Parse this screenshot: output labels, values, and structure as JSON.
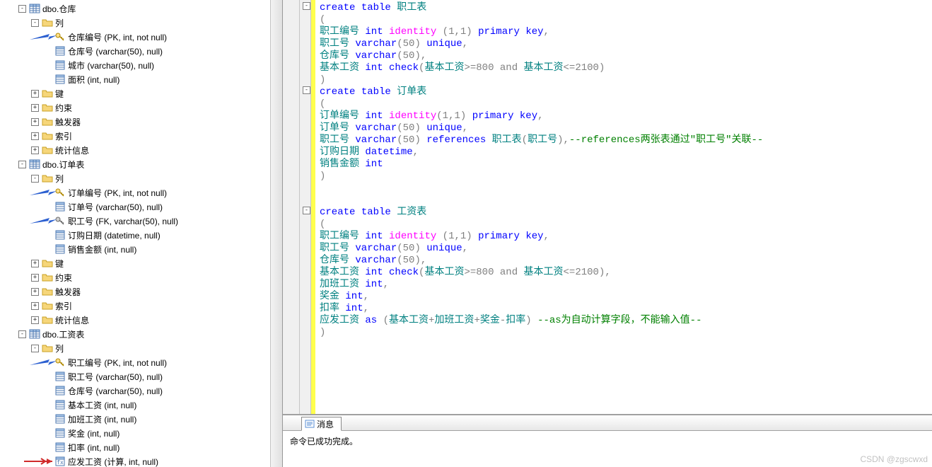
{
  "watermark": "CSDN @zgscwxd",
  "messages": {
    "tab_label": "消息",
    "body": "命令已成功完成。"
  },
  "icons": {
    "table": "table-icon",
    "folder": "folder-icon",
    "key": "key-icon",
    "fkey": "fkey-icon",
    "column": "column-icon",
    "computed": "computed-column-icon"
  },
  "tree": [
    {
      "depth": 1,
      "exp": "-",
      "icon": "table",
      "label": "dbo.仓库",
      "name": "table-dbo-cangku",
      "interact": true
    },
    {
      "depth": 2,
      "exp": "-",
      "icon": "folder",
      "label": "列",
      "name": "folder-columns",
      "interact": true
    },
    {
      "depth": 3,
      "exp": " ",
      "icon": "key",
      "label": "仓库编号 (PK, int, not null)",
      "name": "col-cangku-bianhao",
      "interact": true,
      "arrow": "blue"
    },
    {
      "depth": 3,
      "exp": " ",
      "icon": "column",
      "label": "仓库号 (varchar(50), null)",
      "name": "col-cangku-hao",
      "interact": true
    },
    {
      "depth": 3,
      "exp": " ",
      "icon": "column",
      "label": "城市 (varchar(50), null)",
      "name": "col-chengshi",
      "interact": true
    },
    {
      "depth": 3,
      "exp": " ",
      "icon": "column",
      "label": "面积 (int, null)",
      "name": "col-mianji",
      "interact": true
    },
    {
      "depth": 2,
      "exp": "+",
      "icon": "folder",
      "label": "键",
      "name": "folder-keys",
      "interact": true
    },
    {
      "depth": 2,
      "exp": "+",
      "icon": "folder",
      "label": "约束",
      "name": "folder-constraints",
      "interact": true
    },
    {
      "depth": 2,
      "exp": "+",
      "icon": "folder",
      "label": "触发器",
      "name": "folder-triggers",
      "interact": true
    },
    {
      "depth": 2,
      "exp": "+",
      "icon": "folder",
      "label": "索引",
      "name": "folder-indexes",
      "interact": true
    },
    {
      "depth": 2,
      "exp": "+",
      "icon": "folder",
      "label": "统计信息",
      "name": "folder-stats",
      "interact": true
    },
    {
      "depth": 1,
      "exp": "-",
      "icon": "table",
      "label": "dbo.订单表",
      "name": "table-dbo-dingdan",
      "interact": true
    },
    {
      "depth": 2,
      "exp": "-",
      "icon": "folder",
      "label": "列",
      "name": "folder-columns-2",
      "interact": true
    },
    {
      "depth": 3,
      "exp": " ",
      "icon": "key",
      "label": "订单编号 (PK, int, not null)",
      "name": "col-dingdan-bianhao",
      "interact": true,
      "arrow": "blue"
    },
    {
      "depth": 3,
      "exp": " ",
      "icon": "column",
      "label": "订单号 (varchar(50), null)",
      "name": "col-dingdan-hao",
      "interact": true
    },
    {
      "depth": 3,
      "exp": " ",
      "icon": "fkey",
      "label": "职工号 (FK, varchar(50), null)",
      "name": "col-zhigong-hao-fk",
      "interact": true,
      "arrow": "blue"
    },
    {
      "depth": 3,
      "exp": " ",
      "icon": "column",
      "label": "订购日期 (datetime, null)",
      "name": "col-dinggou-riqi",
      "interact": true
    },
    {
      "depth": 3,
      "exp": " ",
      "icon": "column",
      "label": "销售金额 (int, null)",
      "name": "col-xiaoshou-jine",
      "interact": true
    },
    {
      "depth": 2,
      "exp": "+",
      "icon": "folder",
      "label": "键",
      "name": "folder-keys-2",
      "interact": true
    },
    {
      "depth": 2,
      "exp": "+",
      "icon": "folder",
      "label": "约束",
      "name": "folder-constraints-2",
      "interact": true
    },
    {
      "depth": 2,
      "exp": "+",
      "icon": "folder",
      "label": "触发器",
      "name": "folder-triggers-2",
      "interact": true
    },
    {
      "depth": 2,
      "exp": "+",
      "icon": "folder",
      "label": "索引",
      "name": "folder-indexes-2",
      "interact": true
    },
    {
      "depth": 2,
      "exp": "+",
      "icon": "folder",
      "label": "统计信息",
      "name": "folder-stats-2",
      "interact": true
    },
    {
      "depth": 1,
      "exp": "-",
      "icon": "table",
      "label": "dbo.工资表",
      "name": "table-dbo-gongzi",
      "interact": true
    },
    {
      "depth": 2,
      "exp": "-",
      "icon": "folder",
      "label": "列",
      "name": "folder-columns-3",
      "interact": true
    },
    {
      "depth": 3,
      "exp": " ",
      "icon": "key",
      "label": "职工编号 (PK, int, not null)",
      "name": "col-zhigong-bianhao",
      "interact": true,
      "arrow": "blue"
    },
    {
      "depth": 3,
      "exp": " ",
      "icon": "column",
      "label": "职工号 (varchar(50), null)",
      "name": "col-zhigong-hao",
      "interact": true
    },
    {
      "depth": 3,
      "exp": " ",
      "icon": "column",
      "label": "仓库号 (varchar(50), null)",
      "name": "col-cangku-hao-3",
      "interact": true
    },
    {
      "depth": 3,
      "exp": " ",
      "icon": "column",
      "label": "基本工资 (int, null)",
      "name": "col-jiben-gongzi",
      "interact": true
    },
    {
      "depth": 3,
      "exp": " ",
      "icon": "column",
      "label": "加班工资 (int, null)",
      "name": "col-jiaban-gongzi",
      "interact": true
    },
    {
      "depth": 3,
      "exp": " ",
      "icon": "column",
      "label": "奖金 (int, null)",
      "name": "col-jiangjin",
      "interact": true
    },
    {
      "depth": 3,
      "exp": " ",
      "icon": "column",
      "label": "扣率 (int, null)",
      "name": "col-koulv",
      "interact": true
    },
    {
      "depth": 3,
      "exp": " ",
      "icon": "computed",
      "label": "应发工资 (计算, int, null)",
      "name": "col-yingfa-gongzi",
      "interact": true,
      "arrow": "red"
    }
  ],
  "sql_lines": [
    {
      "fold": "-",
      "tokens": [
        [
          "kw",
          "create"
        ],
        [
          "",
          ""
        ],
        [
          "kw",
          "table"
        ],
        [
          "",
          " "
        ],
        [
          "id",
          "职工表"
        ]
      ]
    },
    {
      "tokens": [
        [
          "punc",
          "("
        ]
      ]
    },
    {
      "tokens": [
        [
          "id",
          "职工编号 "
        ],
        [
          "kw",
          "int"
        ],
        [
          "",
          " "
        ],
        [
          "fn",
          "identity"
        ],
        [
          "",
          " "
        ],
        [
          "punc",
          "("
        ],
        [
          "num",
          "1"
        ],
        [
          "punc",
          ","
        ],
        [
          "num",
          "1"
        ],
        [
          "punc",
          ")"
        ],
        [
          "",
          " "
        ],
        [
          "kw",
          "primary"
        ],
        [
          "",
          " "
        ],
        [
          "kw",
          "key"
        ],
        [
          "punc",
          ","
        ]
      ]
    },
    {
      "tokens": [
        [
          "id",
          "职工号 "
        ],
        [
          "kw",
          "varchar"
        ],
        [
          "punc",
          "("
        ],
        [
          "num",
          "50"
        ],
        [
          "punc",
          ")"
        ],
        [
          "",
          " "
        ],
        [
          "kw",
          "unique"
        ],
        [
          "punc",
          ","
        ]
      ]
    },
    {
      "tokens": [
        [
          "id",
          "仓库号 "
        ],
        [
          "kw",
          "varchar"
        ],
        [
          "punc",
          "("
        ],
        [
          "num",
          "50"
        ],
        [
          "punc",
          ")"
        ],
        [
          "punc",
          ","
        ]
      ]
    },
    {
      "tokens": [
        [
          "id",
          "基本工资 "
        ],
        [
          "kw",
          "int"
        ],
        [
          "",
          " "
        ],
        [
          "kw",
          "check"
        ],
        [
          "punc",
          "("
        ],
        [
          "id",
          "基本工资"
        ],
        [
          "op",
          ">="
        ],
        [
          "num",
          "800"
        ],
        [
          "",
          " "
        ],
        [
          "op",
          "and"
        ],
        [
          "",
          " "
        ],
        [
          "id",
          "基本工资"
        ],
        [
          "op",
          "<="
        ],
        [
          "num",
          "2100"
        ],
        [
          "punc",
          ")"
        ]
      ]
    },
    {
      "tokens": [
        [
          "punc",
          ")"
        ]
      ]
    },
    {
      "fold": "-",
      "tokens": [
        [
          "kw",
          "create"
        ],
        [
          "",
          ""
        ],
        [
          "kw",
          "table"
        ],
        [
          "",
          " "
        ],
        [
          "id",
          "订单表"
        ]
      ]
    },
    {
      "tokens": [
        [
          "punc",
          "("
        ]
      ]
    },
    {
      "tokens": [
        [
          "id",
          "订单编号 "
        ],
        [
          "kw",
          "int"
        ],
        [
          "",
          " "
        ],
        [
          "fn",
          "identity"
        ],
        [
          "punc",
          "("
        ],
        [
          "num",
          "1"
        ],
        [
          "punc",
          ","
        ],
        [
          "num",
          "1"
        ],
        [
          "punc",
          ")"
        ],
        [
          "",
          " "
        ],
        [
          "kw",
          "primary"
        ],
        [
          "",
          " "
        ],
        [
          "kw",
          "key"
        ],
        [
          "punc",
          ","
        ]
      ]
    },
    {
      "tokens": [
        [
          "id",
          "订单号 "
        ],
        [
          "kw",
          "varchar"
        ],
        [
          "punc",
          "("
        ],
        [
          "num",
          "50"
        ],
        [
          "punc",
          ")"
        ],
        [
          "",
          " "
        ],
        [
          "kw",
          "unique"
        ],
        [
          "punc",
          ","
        ]
      ]
    },
    {
      "tokens": [
        [
          "id",
          "职工号 "
        ],
        [
          "kw",
          "varchar"
        ],
        [
          "punc",
          "("
        ],
        [
          "num",
          "50"
        ],
        [
          "punc",
          ")"
        ],
        [
          "",
          " "
        ],
        [
          "kw",
          "references"
        ],
        [
          "",
          " "
        ],
        [
          "id",
          "职工表"
        ],
        [
          "punc",
          "("
        ],
        [
          "id",
          "职工号"
        ],
        [
          "punc",
          ")"
        ],
        [
          "punc",
          ","
        ],
        [
          "cmt",
          "--references两张表通过\"职工号\"关联--"
        ]
      ]
    },
    {
      "tokens": [
        [
          "id",
          "订购日期 "
        ],
        [
          "kw",
          "datetime"
        ],
        [
          "punc",
          ","
        ]
      ]
    },
    {
      "tokens": [
        [
          "id",
          "销售金额 "
        ],
        [
          "kw",
          "int"
        ]
      ]
    },
    {
      "tokens": [
        [
          "punc",
          ")"
        ]
      ]
    },
    {
      "tokens": [
        [
          "",
          ""
        ]
      ]
    },
    {
      "tokens": [
        [
          "",
          ""
        ]
      ]
    },
    {
      "fold": "-",
      "tokens": [
        [
          "kw",
          "create"
        ],
        [
          "",
          ""
        ],
        [
          "kw",
          "table"
        ],
        [
          "",
          " "
        ],
        [
          "id",
          "工资表"
        ]
      ]
    },
    {
      "tokens": [
        [
          "punc",
          "("
        ]
      ]
    },
    {
      "tokens": [
        [
          "id",
          "职工编号 "
        ],
        [
          "kw",
          "int"
        ],
        [
          "",
          " "
        ],
        [
          "fn",
          "identity"
        ],
        [
          "",
          " "
        ],
        [
          "punc",
          "("
        ],
        [
          "num",
          "1"
        ],
        [
          "punc",
          ","
        ],
        [
          "num",
          "1"
        ],
        [
          "punc",
          ")"
        ],
        [
          "",
          " "
        ],
        [
          "kw",
          "primary"
        ],
        [
          "",
          " "
        ],
        [
          "kw",
          "key"
        ],
        [
          "punc",
          ","
        ]
      ]
    },
    {
      "tokens": [
        [
          "id",
          "职工号 "
        ],
        [
          "kw",
          "varchar"
        ],
        [
          "punc",
          "("
        ],
        [
          "num",
          "50"
        ],
        [
          "punc",
          ")"
        ],
        [
          "",
          " "
        ],
        [
          "kw",
          "unique"
        ],
        [
          "punc",
          ","
        ]
      ]
    },
    {
      "tokens": [
        [
          "id",
          "仓库号 "
        ],
        [
          "kw",
          "varchar"
        ],
        [
          "punc",
          "("
        ],
        [
          "num",
          "50"
        ],
        [
          "punc",
          ")"
        ],
        [
          "punc",
          ","
        ]
      ]
    },
    {
      "tokens": [
        [
          "id",
          "基本工资 "
        ],
        [
          "kw",
          "int"
        ],
        [
          "",
          " "
        ],
        [
          "kw",
          "check"
        ],
        [
          "punc",
          "("
        ],
        [
          "id",
          "基本工资"
        ],
        [
          "op",
          ">="
        ],
        [
          "num",
          "800"
        ],
        [
          "",
          " "
        ],
        [
          "op",
          "and"
        ],
        [
          "",
          " "
        ],
        [
          "id",
          "基本工资"
        ],
        [
          "op",
          "<="
        ],
        [
          "num",
          "2100"
        ],
        [
          "punc",
          ")"
        ],
        [
          "punc",
          ","
        ]
      ]
    },
    {
      "tokens": [
        [
          "id",
          "加班工资 "
        ],
        [
          "kw",
          "int"
        ],
        [
          "punc",
          ","
        ]
      ]
    },
    {
      "tokens": [
        [
          "id",
          "奖金 "
        ],
        [
          "kw",
          "int"
        ],
        [
          "punc",
          ","
        ]
      ]
    },
    {
      "tokens": [
        [
          "id",
          "扣率 "
        ],
        [
          "kw",
          "int"
        ],
        [
          "punc",
          ","
        ]
      ]
    },
    {
      "tokens": [
        [
          "id",
          "应发工资 "
        ],
        [
          "kw",
          "as"
        ],
        [
          "",
          " "
        ],
        [
          "punc",
          "("
        ],
        [
          "id",
          "基本工资"
        ],
        [
          "op",
          "+"
        ],
        [
          "id",
          "加班工资"
        ],
        [
          "op",
          "+"
        ],
        [
          "id",
          "奖金"
        ],
        [
          "op",
          "-"
        ],
        [
          "id",
          "扣率"
        ],
        [
          "punc",
          ")"
        ],
        [
          "",
          " "
        ],
        [
          "cmt",
          "--as为自动计算字段，不能输入值--"
        ]
      ]
    },
    {
      "tokens": [
        [
          "punc",
          ")"
        ]
      ]
    }
  ]
}
